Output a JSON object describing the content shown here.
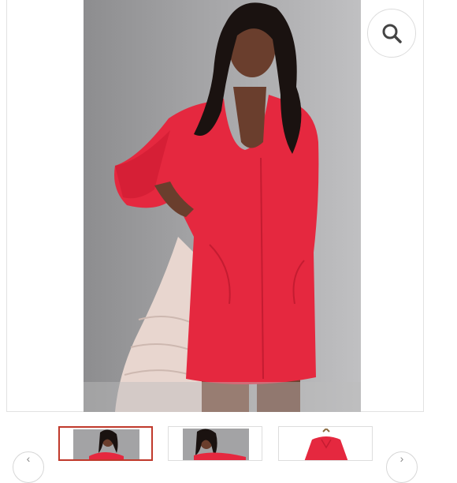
{
  "product": {
    "image_description_icon": "product-photo",
    "accent_color": "#e5283f"
  },
  "viewer": {
    "zoom_icon": "search-icon"
  },
  "thumbnails": [
    {
      "icon": "thumb-model-front",
      "active": true
    },
    {
      "icon": "thumb-model-detail",
      "active": false
    },
    {
      "icon": "thumb-dress-flat",
      "active": false
    }
  ],
  "nav": {
    "prev_icon": "chevron-left-icon",
    "next_icon": "chevron-right-icon"
  },
  "colors": {
    "active_thumb_border": "#c0392b",
    "dress": "#e5283f",
    "backdrop": "#a3a3a5"
  }
}
